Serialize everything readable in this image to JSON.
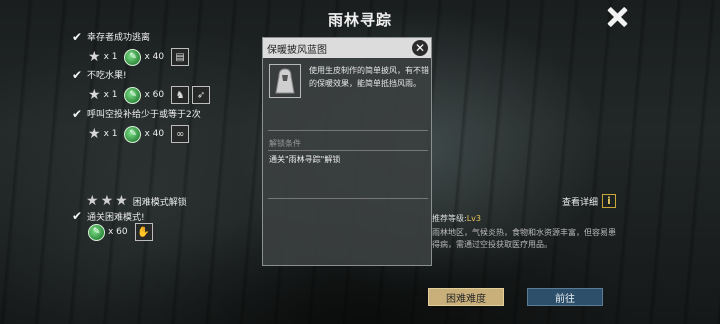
{
  "title": "雨林寻踪",
  "objectives": [
    {
      "text": "幸存者成功逃离",
      "stars": 1,
      "star_qty": "x 1",
      "gem_qty": "x 40",
      "items": [
        "note-icon"
      ]
    },
    {
      "text": "不吃水果!",
      "stars": 1,
      "star_qty": "x 1",
      "gem_qty": "x 60",
      "items": [
        "cloak-icon",
        "blueprint-icon"
      ]
    },
    {
      "text": "呼叫空投补给少于或等于2次",
      "stars": 1,
      "star_qty": "x 1",
      "gem_qty": "x 40",
      "items": [
        "mask-icon"
      ]
    }
  ],
  "hard_mode": {
    "title": "困难模式解锁",
    "objective": "通关困难模式!",
    "gem_qty": "x 60"
  },
  "popup": {
    "title": "保暖披风蓝图",
    "description": "使用生皮制作的简单披风，有不错的保暖效果，能简单抵挡风雨。",
    "unlock_label": "解锁条件",
    "unlock_text": "通关\"雨林寻踪\"解锁"
  },
  "details": {
    "link": "查看详细",
    "rec_level_label": "推荐等级:",
    "rec_level_value": "Lv3",
    "area_desc": "雨林地区，气候炎热，食物和水资源丰富，但容易患得病，需通过空投获取医疗用品。"
  },
  "buttons": {
    "hard": "困难难度",
    "go": "前往"
  }
}
